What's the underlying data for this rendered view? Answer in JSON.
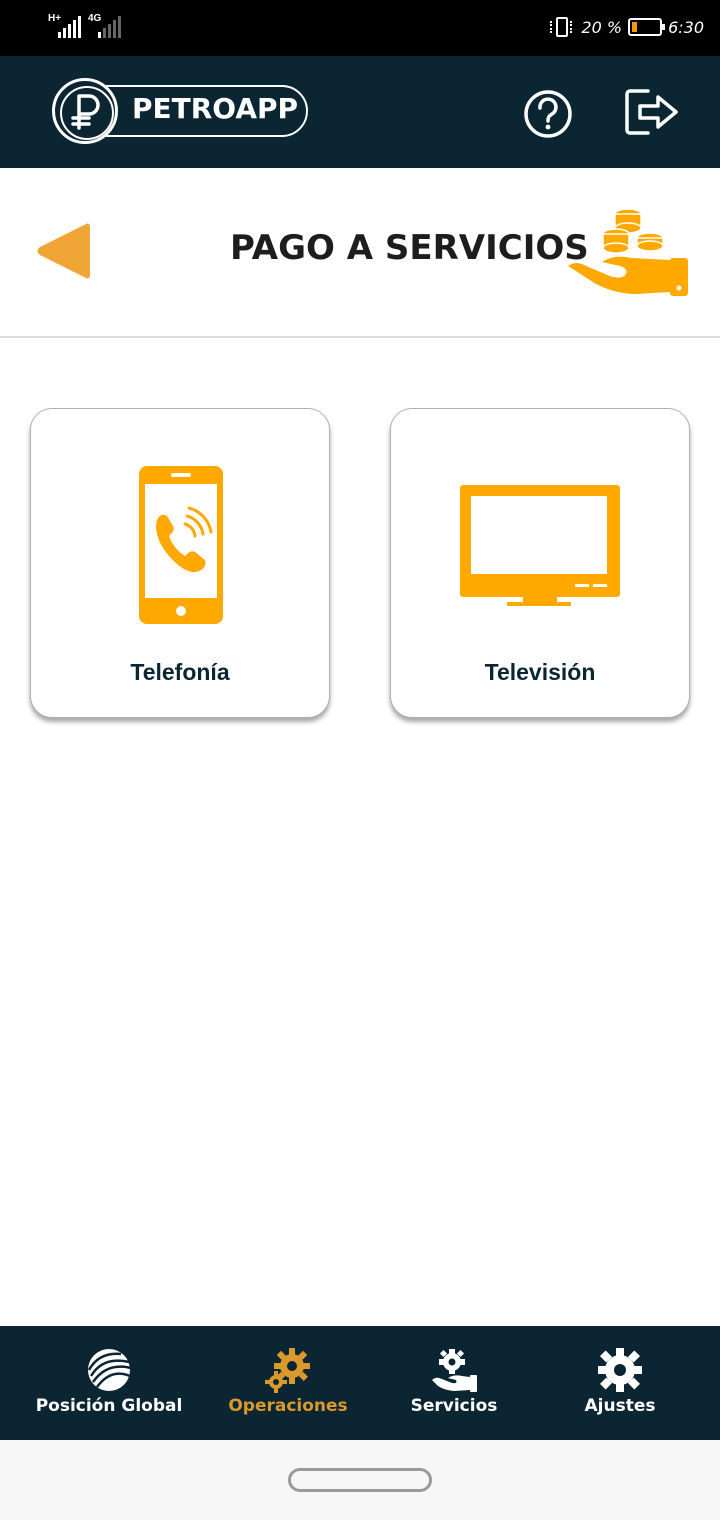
{
  "status_bar": {
    "network_1": "H+",
    "network_2": "4G",
    "battery_percent": "20 %",
    "battery_level": 0.2,
    "time": "6:30"
  },
  "header": {
    "app_name": "PETROAPP",
    "help_icon": "question-circle-icon",
    "logout_icon": "logout-icon"
  },
  "page": {
    "title": "PAGO A SERVICIOS",
    "back_icon": "back-triangle-icon",
    "title_icon": "hand-coins-icon"
  },
  "services": [
    {
      "label": "Telefonía",
      "icon": "phone-call-icon"
    },
    {
      "label": "Televisión",
      "icon": "television-icon"
    }
  ],
  "bottom_nav": {
    "items": [
      {
        "label": "Posición Global",
        "icon": "globe-icon"
      },
      {
        "label": "Operaciones",
        "icon": "gears-icon",
        "active": true
      },
      {
        "label": "Servicios",
        "icon": "hand-gear-icon"
      },
      {
        "label": "Ajustes",
        "icon": "gear-icon"
      }
    ]
  },
  "colors": {
    "primary_dark": "#0b2533",
    "accent_orange": "#ffa800",
    "active_nav": "#d99a2b",
    "back_arrow": "#f0a637"
  }
}
